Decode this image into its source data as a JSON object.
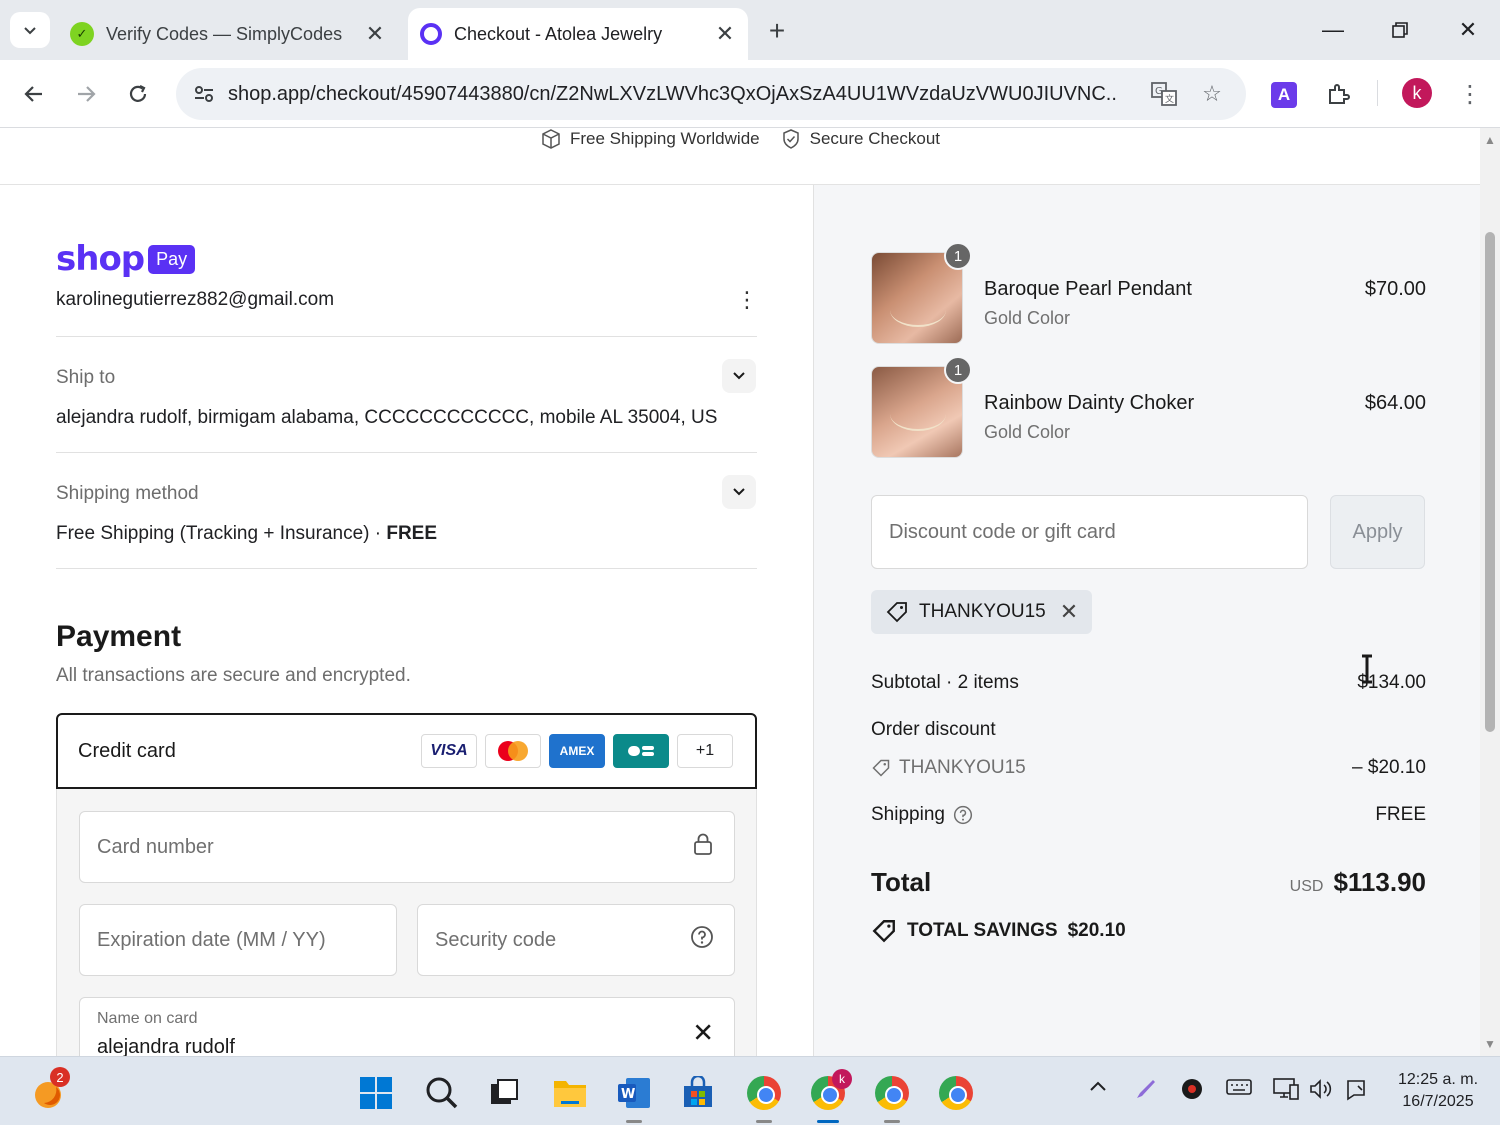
{
  "browser": {
    "tabs": [
      {
        "title": "Verify Codes — SimplyCodes",
        "active": false
      },
      {
        "title": "Checkout - Atolea Jewelry",
        "active": true
      }
    ],
    "url": "shop.app/checkout/45907443880/cn/Z2NwLXVzLWVhc3QxOjAxSzA4UU1WVzdaUzVWU0JIUVNC...",
    "profile_initial": "k",
    "extension_letter": "A"
  },
  "topbar": {
    "shipping": "Free Shipping Worldwide",
    "secure": "Secure Checkout"
  },
  "shop_pay": {
    "word": "shop",
    "badge": "Pay",
    "email": "karolinegutierrez882@gmail.com"
  },
  "ship_to": {
    "label": "Ship to",
    "value": "alejandra rudolf, birmigam alabama, CCCCCCCCCCCC, mobile AL 35004, US"
  },
  "shipping_method": {
    "label": "Shipping method",
    "value": "Free Shipping (Tracking + Insurance) · ",
    "price": "FREE"
  },
  "payment": {
    "title": "Payment",
    "subtitle": "All transactions are secure and encrypted.",
    "method_label": "Credit card",
    "cards": [
      "VISA",
      "",
      "AMEX",
      "",
      "+1"
    ],
    "card_number_placeholder": "Card number",
    "expiry_placeholder": "Expiration date (MM / YY)",
    "security_placeholder": "Security code",
    "name_label": "Name on card",
    "name_value": "alejandra rudolf"
  },
  "order": {
    "items": [
      {
        "name": "Baroque Pearl Pendant",
        "variant": "Gold Color",
        "price": "$70.00",
        "qty": "1"
      },
      {
        "name": "Rainbow Dainty Choker",
        "variant": "Gold Color",
        "price": "$64.00",
        "qty": "1"
      }
    ],
    "discount_placeholder": "Discount code or gift card",
    "apply_label": "Apply",
    "applied_code": "THANKYOU15",
    "subtotal_label": "Subtotal · 2 items",
    "subtotal_value": "$134.00",
    "order_discount_label": "Order discount",
    "discount_code": "THANKYOU15",
    "discount_value": "– $20.10",
    "shipping_label": "Shipping",
    "shipping_value": "FREE",
    "total_label": "Total",
    "currency": "USD",
    "total_value": "$113.90",
    "savings_label": "TOTAL SAVINGS",
    "savings_value": "$20.10"
  },
  "taskbar": {
    "notification_count": "2",
    "time": "12:25 a. m.",
    "date": "16/7/2025"
  }
}
